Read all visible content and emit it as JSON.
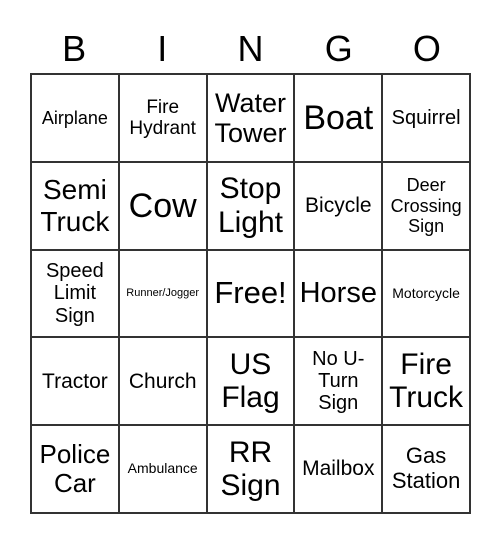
{
  "header": [
    "B",
    "I",
    "N",
    "G",
    "O"
  ],
  "cells": [
    [
      "Airplane",
      "Fire Hydrant",
      "Water Tower",
      "Boat",
      "Squirrel"
    ],
    [
      "Semi Truck",
      "Cow",
      "Stop Light",
      "Bicycle",
      "Deer Crossing Sign"
    ],
    [
      "Speed Limit Sign",
      "Runner/Jogger",
      "Free!",
      "Horse",
      "Motorcycle"
    ],
    [
      "Tractor",
      "Church",
      "US Flag",
      "No U-Turn Sign",
      "Fire Truck"
    ],
    [
      "Police Car",
      "Ambulance",
      "RR Sign",
      "Mailbox",
      "Gas Station"
    ]
  ]
}
